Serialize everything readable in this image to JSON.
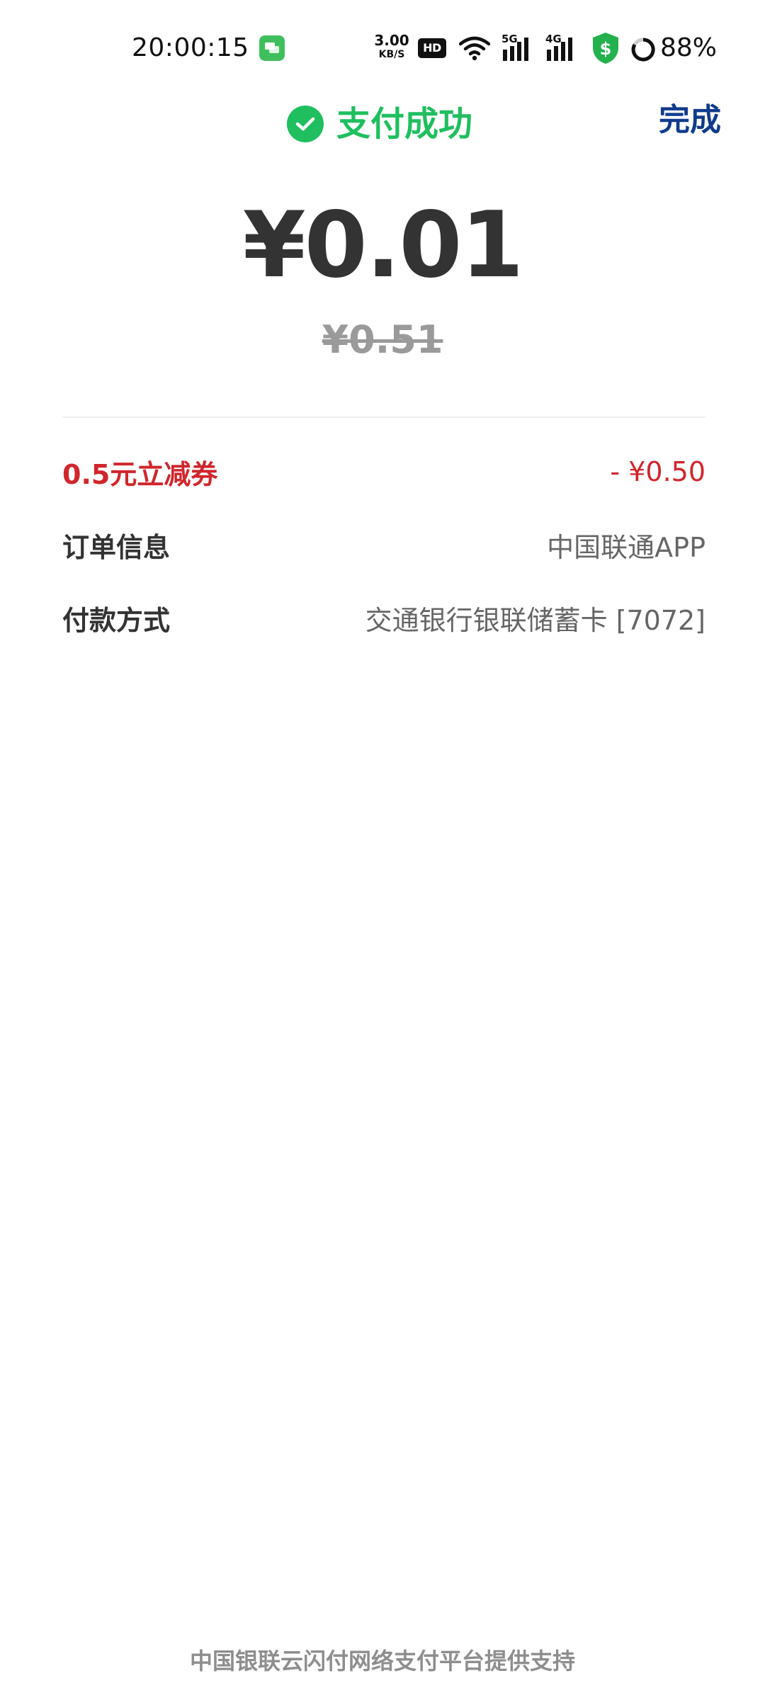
{
  "status_bar": {
    "time": "20:00:15",
    "net_speed_value": "3.00",
    "net_speed_unit": "KB/S",
    "hd_label": "HD",
    "sig1_label": "5G",
    "sig2_label": "4G",
    "battery": "88%"
  },
  "header": {
    "title": "支付成功",
    "done_label": "完成",
    "title_color": "#1fbf5f",
    "done_color": "#103b8c"
  },
  "amount": {
    "paid": "¥0.01",
    "original": "¥0.51"
  },
  "details": {
    "coupon": {
      "label": "0.5元立减券",
      "value": "- ¥0.50",
      "color": "#d0262c"
    },
    "order": {
      "label": "订单信息",
      "value": "中国联通APP"
    },
    "payment": {
      "label": "付款方式",
      "value": "交通银行银联储蓄卡 [7072]"
    }
  },
  "footer": {
    "text": "中国银联云闪付网络支付平台提供支持"
  }
}
